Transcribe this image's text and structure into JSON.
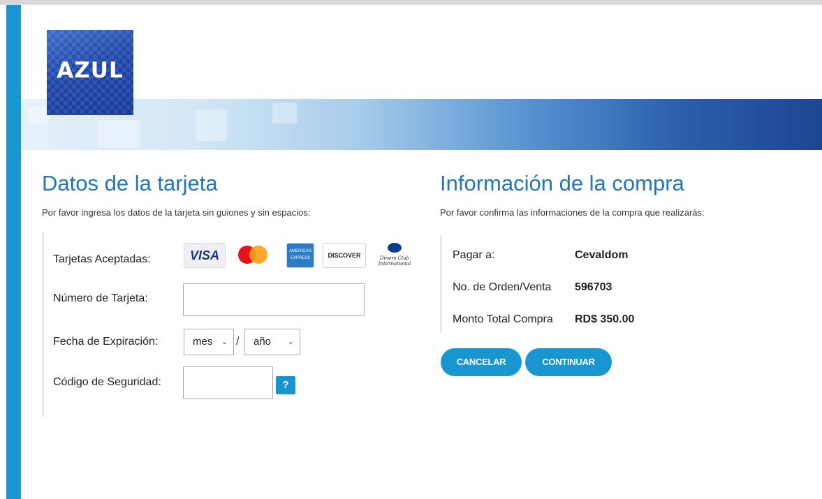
{
  "brand": {
    "logo_text": "AZUL"
  },
  "card_section": {
    "title": "Datos de la tarjeta",
    "instructions": "Por favor ingresa los datos de la tarjeta sin guiones y sin espacios:",
    "accepted_label": "Tarjetas Aceptadas:",
    "accepted_cards": {
      "visa": "VISA",
      "amex": "AMERICAN EXPRESS",
      "discover": "DISCOVER",
      "diners": "Diners Club International"
    },
    "card_number_label": "Número de Tarjeta:",
    "card_number_value": "",
    "expiry_label": "Fecha de Expiración:",
    "expiry_month": "mes",
    "expiry_separator": "/",
    "expiry_year": "año",
    "cvv_label": "Código de Seguridad:",
    "cvv_value": "",
    "help_label": "?"
  },
  "purchase_section": {
    "title": "Información de la compra",
    "instructions": "Por favor confirma las informaciones de la compra que realizarás:",
    "pay_to_label": "Pagar a:",
    "pay_to_value": "Cevaldom",
    "order_label": "No. de Orden/Venta",
    "order_value": "596703",
    "total_label": "Monto Total Compra",
    "total_value": "RD$ 350.00"
  },
  "actions": {
    "cancel": "CANCELAR",
    "continue": "CONTINUAR"
  },
  "colors": {
    "accent": "#1996cf",
    "title": "#2176bb",
    "logo": "#1f48a8"
  }
}
